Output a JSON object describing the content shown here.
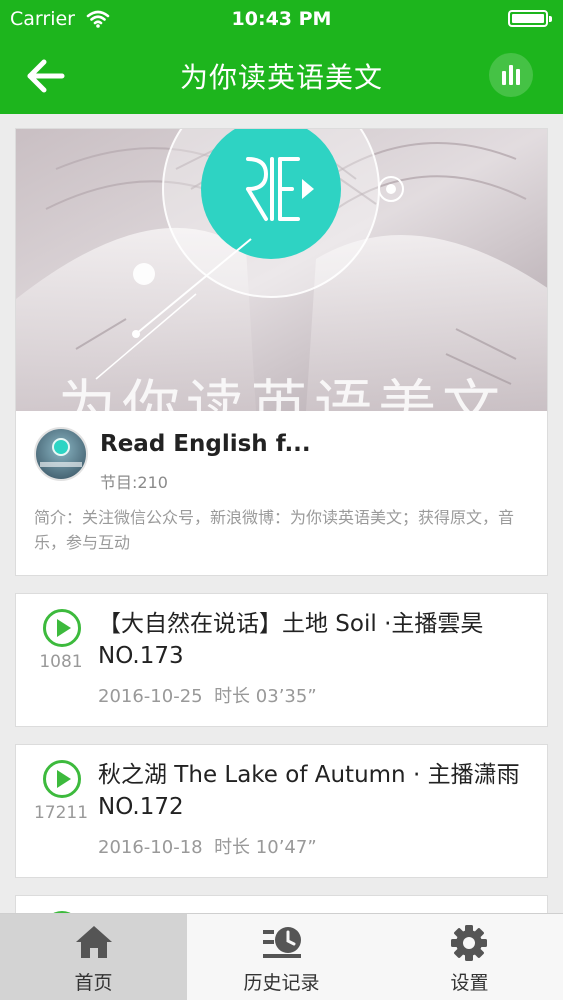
{
  "status_bar": {
    "carrier": "Carrier",
    "time": "10:43 PM"
  },
  "nav": {
    "back_icon": "arrow-left-icon",
    "title": "为你读英语美文",
    "now_playing_icon": "equalizer-icon"
  },
  "colors": {
    "brand_green": "#1db51d",
    "play_green": "#3dba3d"
  },
  "album": {
    "cover_overlay_text": "为你读英语美文",
    "title": "Read English f...",
    "episode_count": "节目:210",
    "intro": "简介：关注微信公众号，新浪微博：为你读英语美文；获得原文，音乐，参与互动"
  },
  "episodes": [
    {
      "title": "【大自然在说话】土地 Soil ·主播雲昊 NO.173",
      "plays": "1081",
      "date": "2016-10-25",
      "duration": "时长 03’35”"
    },
    {
      "title": "秋之湖 The Lake of Autumn · 主播潇雨 NO.172",
      "plays": "17211",
      "date": "2016-10-18",
      "duration": "时长 10’47”"
    }
  ],
  "tabs": [
    {
      "label": "首页",
      "icon": "home-icon",
      "active": true
    },
    {
      "label": "历史记录",
      "icon": "history-icon",
      "active": false
    },
    {
      "label": "设置",
      "icon": "gear-icon",
      "active": false
    }
  ]
}
